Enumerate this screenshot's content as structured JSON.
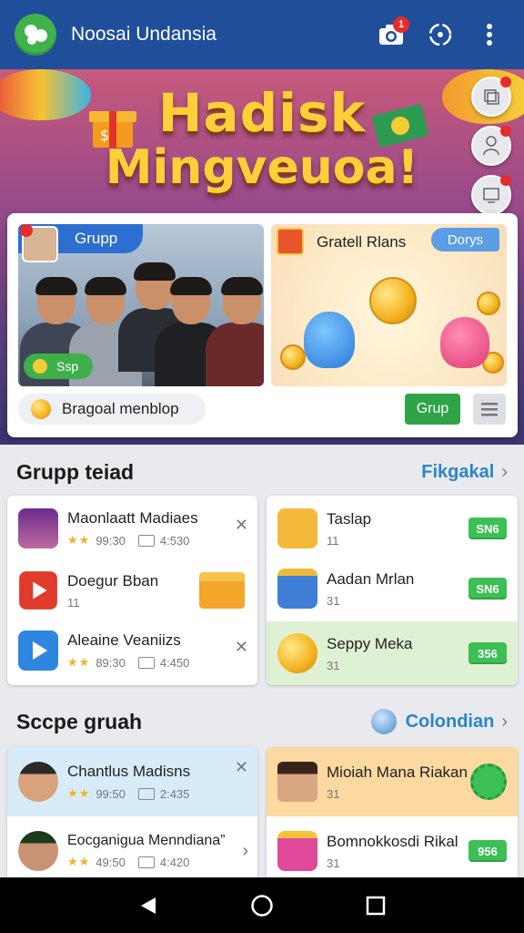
{
  "appbar": {
    "title": "Noosai Undansia",
    "camera_badge": "1"
  },
  "hero": {
    "headline_line1": "Hadisk",
    "headline_line2": "Mingveuoa!",
    "group_tag": "Grupp",
    "group_pill": "Ssp",
    "promo_title": "Gratell Rlans",
    "promo_badge": "Dorys",
    "brand_pill": "Bragoal menblop",
    "grup_button": "Grup"
  },
  "section1": {
    "title": "Grupp teiad",
    "link": "Fikgakal",
    "left_items": [
      {
        "title": "Maonlaatt Madiaes",
        "rating": "99:30",
        "time": "4:530"
      },
      {
        "title": "Doegur Bban",
        "count": "11"
      },
      {
        "title": "Aleaine Veaniizs",
        "rating": "89:30",
        "time": "4:450"
      }
    ],
    "right_items": [
      {
        "title": "Taslap",
        "count": "11",
        "badge": "SN6"
      },
      {
        "title": "Aadan Mrlan",
        "count": "31",
        "badge": "SN6"
      },
      {
        "title": "Seppy Meka",
        "count": "31",
        "badge": "356"
      }
    ]
  },
  "section2": {
    "title": "Sccpe gruah",
    "link": "Colondian",
    "left_items": [
      {
        "title": "Chantlus Madisns",
        "rating": "99:50",
        "time": "2:435"
      },
      {
        "title": "Eocganigua Menndiana”",
        "rating": "49:50",
        "time": "4:420"
      }
    ],
    "right_items": [
      {
        "title": "Mioiah Mana Riakan",
        "count": "31"
      },
      {
        "title": "Bomnokkosdi Rikal",
        "count": "31",
        "badge": "956"
      }
    ]
  },
  "colors": {
    "appbar": "#1f4f9a",
    "accent_green": "#2fa446",
    "accent_blue": "#2a86c8",
    "highlight_green_row": "#dff1d3",
    "highlight_blue_row": "#d7ecf8",
    "highlight_orange_row": "#fbd9a0"
  },
  "icons": [
    "app-logo-icon",
    "camera-icon",
    "sync-icon",
    "more-vert-icon",
    "back-icon",
    "home-icon",
    "recents-icon"
  ]
}
